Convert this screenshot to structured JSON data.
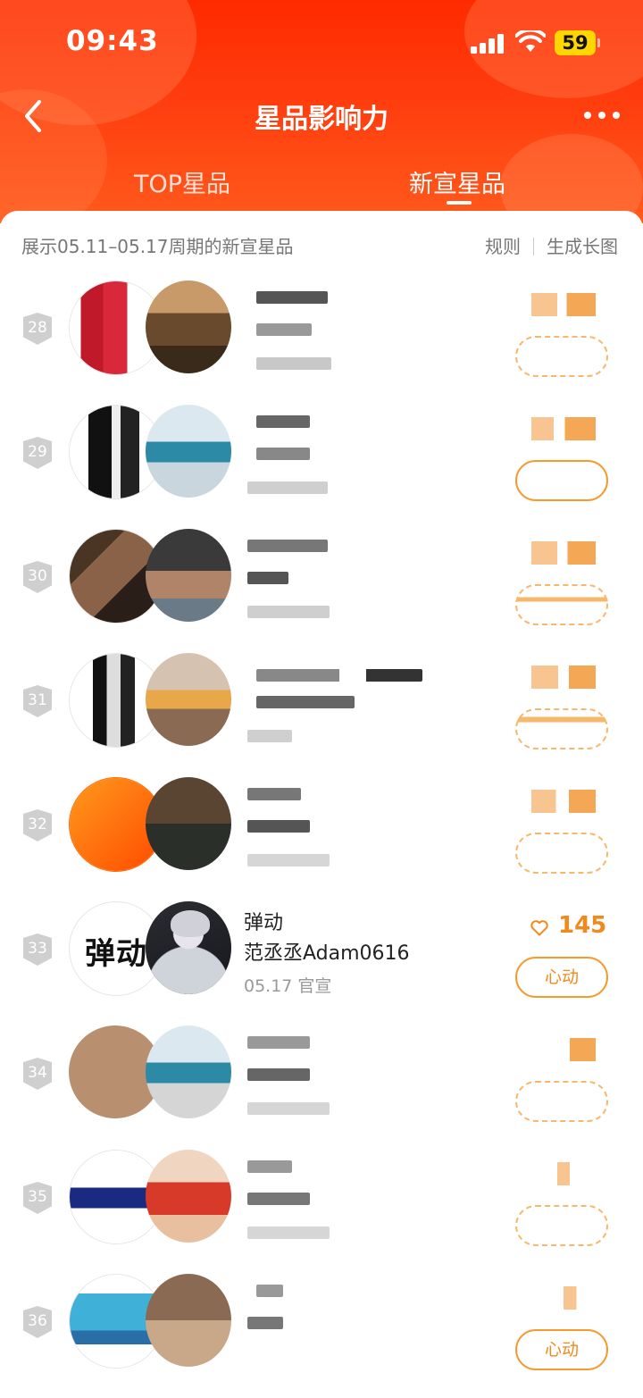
{
  "status_bar": {
    "time": "09:43",
    "battery": "59"
  },
  "nav": {
    "title": "星品影响力"
  },
  "tabs": [
    {
      "label": "TOP星品",
      "active": false
    },
    {
      "label": "新宣星品",
      "active": true
    }
  ],
  "info_bar": {
    "period_text": "展示05.11–05.17周期的新宣星品",
    "rules_label": "规则",
    "long_image_label": "生成长图"
  },
  "list": [
    {
      "rank": "28",
      "obscured": true
    },
    {
      "rank": "29",
      "obscured": true
    },
    {
      "rank": "30",
      "obscured": true
    },
    {
      "rank": "31",
      "obscured": true
    },
    {
      "rank": "32",
      "obscured": true
    },
    {
      "rank": "33",
      "obscured": false,
      "brand": "弹动",
      "name": "弹动",
      "endorser": "范丞丞Adam0616",
      "date": "05.17 官宣",
      "likes": "145",
      "button": "心动",
      "brand_logo_text": "弹动"
    },
    {
      "rank": "34",
      "obscured": true
    },
    {
      "rank": "35",
      "obscured": true
    },
    {
      "rank": "36",
      "obscured": true,
      "button": "心动"
    }
  ],
  "colors": {
    "header": "#ff3d0e",
    "accent": "#f08a1c",
    "rank_badge": "#cfcfcf"
  }
}
